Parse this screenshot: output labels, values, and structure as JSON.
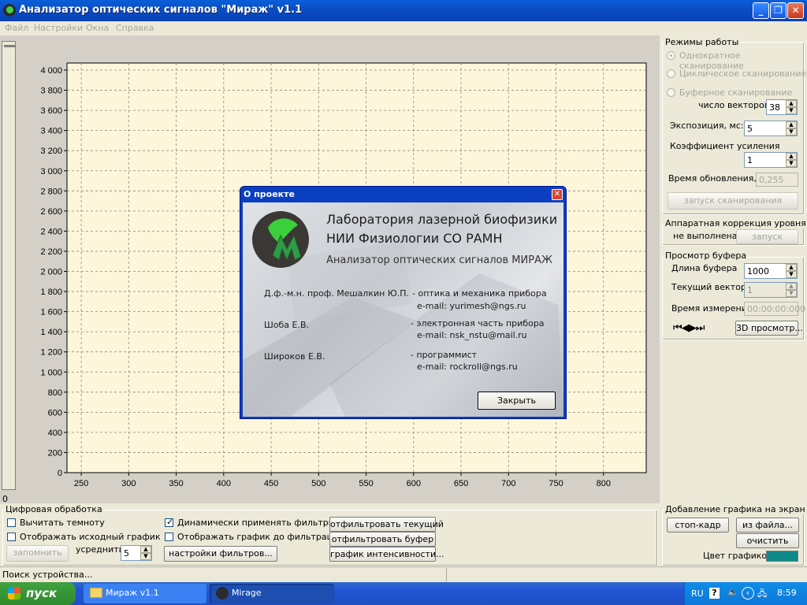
{
  "window": {
    "title": "Анализатор оптических сигналов \"Мираж\" v1.1",
    "controls": [
      "minimize-icon",
      "restore-icon",
      "close-icon"
    ]
  },
  "menu": [
    "Файл",
    "Настройки",
    "Окна",
    "Справка"
  ],
  "ruler": {
    "value": "0"
  },
  "chart_data": {
    "type": "line",
    "x_ticks": [
      "250",
      "300",
      "350",
      "400",
      "450",
      "500",
      "550",
      "600",
      "650",
      "700",
      "750",
      "800"
    ],
    "y_ticks": [
      "4 000",
      "3 800",
      "3 600",
      "3 400",
      "3 200",
      "3 000",
      "2 800",
      "2 600",
      "2 400",
      "2 200",
      "2 000",
      "1 800",
      "1 600",
      "1 400",
      "1 200",
      "1 000",
      "800",
      "600",
      "400",
      "200",
      "0"
    ],
    "xlim": [
      235,
      845
    ],
    "ylim": [
      0,
      4000
    ],
    "grid": true,
    "series": [],
    "plot_background": "#fdf6db"
  },
  "modes": {
    "title": "Режимы работы",
    "options": [
      "Однократное сканирование",
      "Циклическое сканирование",
      "Буферное сканирование"
    ],
    "vectors_label": "число векторов",
    "vectors_value": "38",
    "exposure_label": "Экспозиция, мс:",
    "exposure_value": "5",
    "gain_label": "Коэффициент усиления",
    "gain_value": "1",
    "refresh_label": "Время обновления, с",
    "refresh_value": "0,255",
    "scan_button": "запуск сканирования"
  },
  "hardware": {
    "title": "Аппаратная коррекция уровня",
    "status": "не выполнена",
    "button": "запуск"
  },
  "buffer": {
    "title": "Просмотр буфера",
    "length_label": "Длина буфера",
    "length_value": "1000",
    "current_label": "Текущий вектор",
    "current_value": "1",
    "time_label": "Время измерения",
    "time_value": "00:00:00:000",
    "view3d_button": "3D просмотр..."
  },
  "digital": {
    "title": "Цифровая обработка",
    "subtract_dark": "Вычитать темноту",
    "show_source": "Отображать исходный график",
    "remember_button": "запомнить",
    "average_label": "усреднить",
    "average_value": "5",
    "dynamic_filters": "Динамически применять фильтры",
    "show_before_filter": "Отображать график до фильтрации",
    "filter_settings_button": "настройки фильтров...",
    "filter_current_button": "отфильтровать текущий",
    "filter_buffer_button": "отфильтровать буфер",
    "intensity_button": "график интенсивности..."
  },
  "add_graph": {
    "title": "Добавление графика на экран",
    "freeze_button": "стоп-кадр",
    "from_file_button": "из файла...",
    "clear_button": "очистить",
    "color_label": "Цвет графиков",
    "color": "#0e8a8a"
  },
  "status": {
    "text": "Поиск устройства..."
  },
  "taskbar": {
    "start": "пуск",
    "tasks": [
      "Мираж v1.1",
      "Mirage"
    ],
    "lang": "RU",
    "clock": "8:59"
  },
  "dialog": {
    "title": "О проекте",
    "heading1": "Лаборатория  лазерной биофизики",
    "heading2": "НИИ Физиологии СО РАМН",
    "subheading": "Анализатор оптических сигналов МИРАЖ",
    "people": [
      {
        "name": "Д.ф.-м.н. проф. Мешалкин Ю.П.",
        "role": "- оптика и механика прибора",
        "email": "e-mail: yurimesh@ngs.ru"
      },
      {
        "name": "Шоба Е.В.",
        "role": "- электронная часть прибора",
        "email": "e-mail: nsk_nstu@mail.ru"
      },
      {
        "name": "Широков Е.В.",
        "role": "- программист",
        "email": "e-mail: rockroll@ngs.ru"
      }
    ],
    "close_button": "Закрыть"
  }
}
